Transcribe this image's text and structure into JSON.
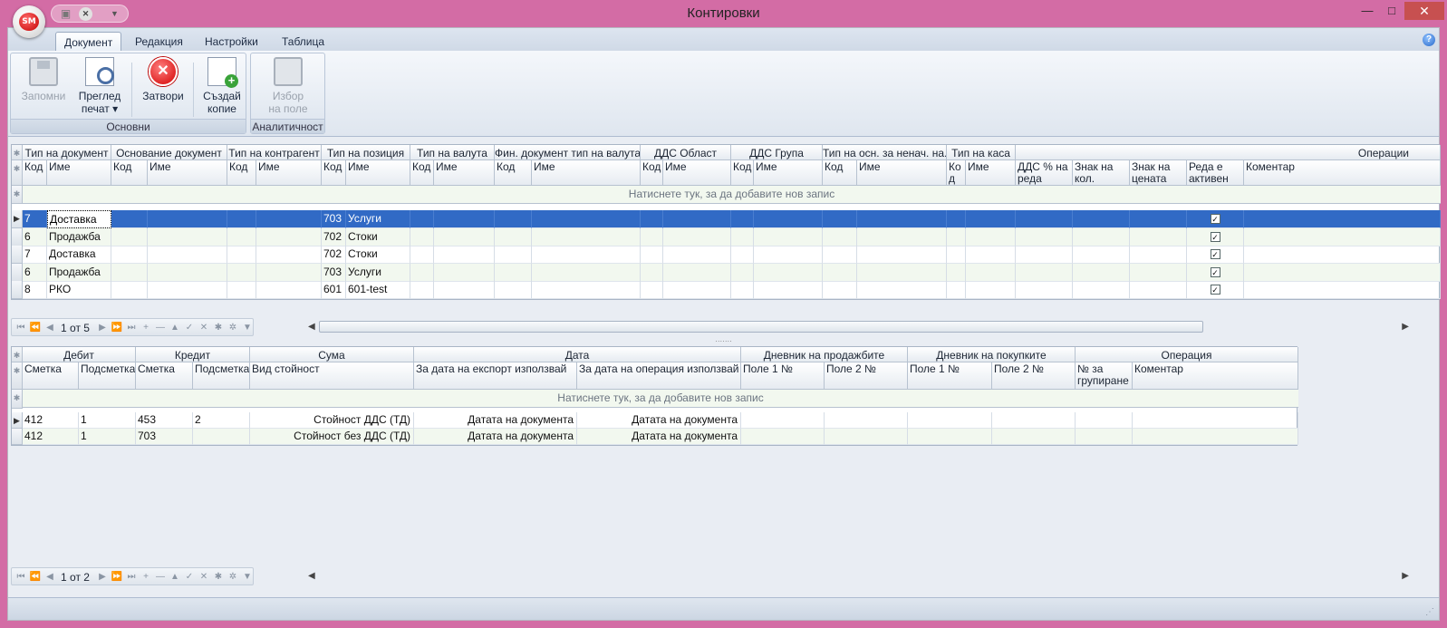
{
  "window": {
    "title": "Контировки",
    "app_logo": "SM",
    "min_icon": "minimize-icon",
    "max_icon": "maximize-icon",
    "close_icon": "close-icon"
  },
  "ribbon": {
    "tabs": [
      "Документ",
      "Редакция",
      "Настройки",
      "Таблица"
    ],
    "active_tab": "Документ",
    "groups": [
      {
        "caption": "Основни",
        "buttons": [
          {
            "label1": "Запомни",
            "label2": "",
            "icon": "save-icon",
            "enabled": false
          },
          {
            "label1": "Преглед",
            "label2": "печат ▾",
            "icon": "print-preview-icon",
            "enabled": true
          },
          {
            "label1": "Затвори",
            "label2": "",
            "icon": "close-circle-icon",
            "enabled": true
          },
          {
            "label1": "Създай",
            "label2": "копие",
            "icon": "copy-add-icon",
            "enabled": true
          }
        ]
      },
      {
        "caption": "Аналитичност",
        "buttons": [
          {
            "label1": "Избор",
            "label2": "на поле",
            "icon": "field-select-icon",
            "enabled": false
          }
        ]
      }
    ]
  },
  "top_grid": {
    "bands": [
      "Тип на документ",
      "Основание документ",
      "Тип на контрагент",
      "Тип на позиция",
      "Тип на валута",
      "Фин. документ тип на валута",
      "ДДС Област",
      "ДДС Група",
      "Тип на осн. за ненач. на...",
      "Тип на каса",
      "Операции"
    ],
    "columns": [
      "Код",
      "Име",
      "Код",
      "Име",
      "Код",
      "Име",
      "Код",
      "Име",
      "Код",
      "Име",
      "Код",
      "Име",
      "Код",
      "Име",
      "Код",
      "Име",
      "Код",
      "Име",
      "Ко д",
      "Име",
      "ДДС % на реда",
      "Знак на кол.",
      "Знак на цената",
      "Реда е активен",
      "Коментар"
    ],
    "new_row_text": "Натиснете тук, за да добавите нов запис",
    "rows": [
      {
        "doc_code": "7",
        "doc_name": "Доставка",
        "pos_code": "703",
        "pos_name": "Услуги",
        "active": "✓"
      },
      {
        "doc_code": "6",
        "doc_name": "Продажба",
        "pos_code": "702",
        "pos_name": "Стоки",
        "active": "✓"
      },
      {
        "doc_code": "7",
        "doc_name": "Доставка",
        "pos_code": "702",
        "pos_name": "Стоки",
        "active": "✓"
      },
      {
        "doc_code": "6",
        "doc_name": "Продажба",
        "pos_code": "703",
        "pos_name": "Услуги",
        "active": "✓"
      },
      {
        "doc_code": "8",
        "doc_name": "РКО",
        "pos_code": "601",
        "pos_name": "601-test",
        "active": "✓"
      }
    ],
    "record_position": "1 от 5"
  },
  "bottom_grid": {
    "bands": [
      "Дебит",
      "Кредит",
      "Сума",
      "Дата",
      "Дневник на продажбите",
      "Дневник на покупките",
      "Операция"
    ],
    "columns": [
      "Сметка",
      "Подсметка",
      "Сметка",
      "Подсметка",
      "Вид стойност",
      "За дата на експорт използвай",
      "За дата на операция използвай",
      "Поле 1 №",
      "Поле 2 №",
      "Поле 1 №",
      "Поле 2 №",
      "№ за групиране",
      "Коментар"
    ],
    "new_row_text": "Натиснете тук, за да добавите нов запис",
    "rows": [
      {
        "debit_acc": "412",
        "debit_sub": "1",
        "credit_acc": "453",
        "credit_sub": "2",
        "value_type": "Стойност ДДС (ТД)",
        "export_date": "Датата на документа",
        "op_date": "Датата на документа"
      },
      {
        "debit_acc": "412",
        "debit_sub": "1",
        "credit_acc": "703",
        "credit_sub": "",
        "value_type": "Стойност без ДДС (ТД)",
        "export_date": "Датата на документа",
        "op_date": "Датата на документа"
      }
    ],
    "record_position": "1 от 2"
  },
  "navigator": {
    "buttons": [
      "⏮",
      "⏪",
      "◀",
      "▶",
      "⏩",
      "⏭",
      "+",
      "—",
      "▲",
      "✓",
      "✕",
      "✱",
      "✲",
      "▼"
    ]
  },
  "help_icon": "?"
}
